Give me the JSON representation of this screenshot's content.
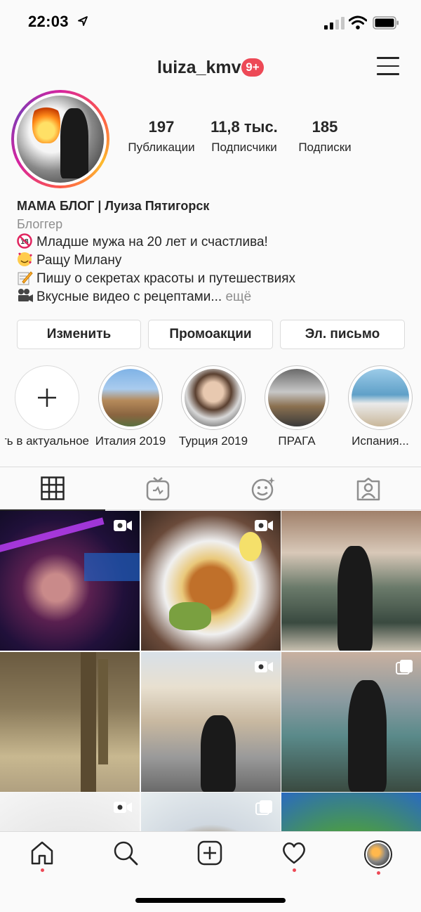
{
  "status_bar": {
    "time": "22:03"
  },
  "header": {
    "username": "luiza_kmv",
    "notifications": "9+"
  },
  "profile": {
    "stats": [
      {
        "value": "197",
        "label": "Публикации"
      },
      {
        "value": "11,8 тыс.",
        "label": "Подписчики"
      },
      {
        "value": "185",
        "label": "Подписки"
      }
    ],
    "name": "МАМА БЛОГ | Луиза Пятигорск",
    "category": "Блоггер",
    "bio_lines": [
      "Младше мужа на 20 лет и счастлива!",
      "Ращу Милану",
      "Пишу о секретах красоты и путешествиях",
      "Вкусные видео с рецептами..."
    ],
    "bio_more": "ещё"
  },
  "buttons": {
    "edit": "Изменить",
    "promotions": "Промоакции",
    "email": "Эл. письмо"
  },
  "highlights": [
    {
      "label": "Добавить в актуальное",
      "icon": "plus-icon"
    },
    {
      "label": "Италия 2019"
    },
    {
      "label": "Турция 2019"
    },
    {
      "label": "ПРАГА"
    },
    {
      "label": "Испания..."
    }
  ],
  "tabs": [
    "grid-icon",
    "igtv-icon",
    "tagged-face-icon",
    "tagged-person-icon"
  ],
  "grid_types": [
    "video",
    "video",
    "photo",
    "photo",
    "video",
    "carousel",
    "video",
    "carousel",
    "photo"
  ],
  "nav": [
    "home-icon",
    "search-icon",
    "add-post-icon",
    "heart-icon",
    "profile-avatar"
  ],
  "colors": {
    "accent_red": "#ed4956",
    "text": "#262626",
    "secondary": "#8e8e8e",
    "border": "#dbdbdb"
  }
}
